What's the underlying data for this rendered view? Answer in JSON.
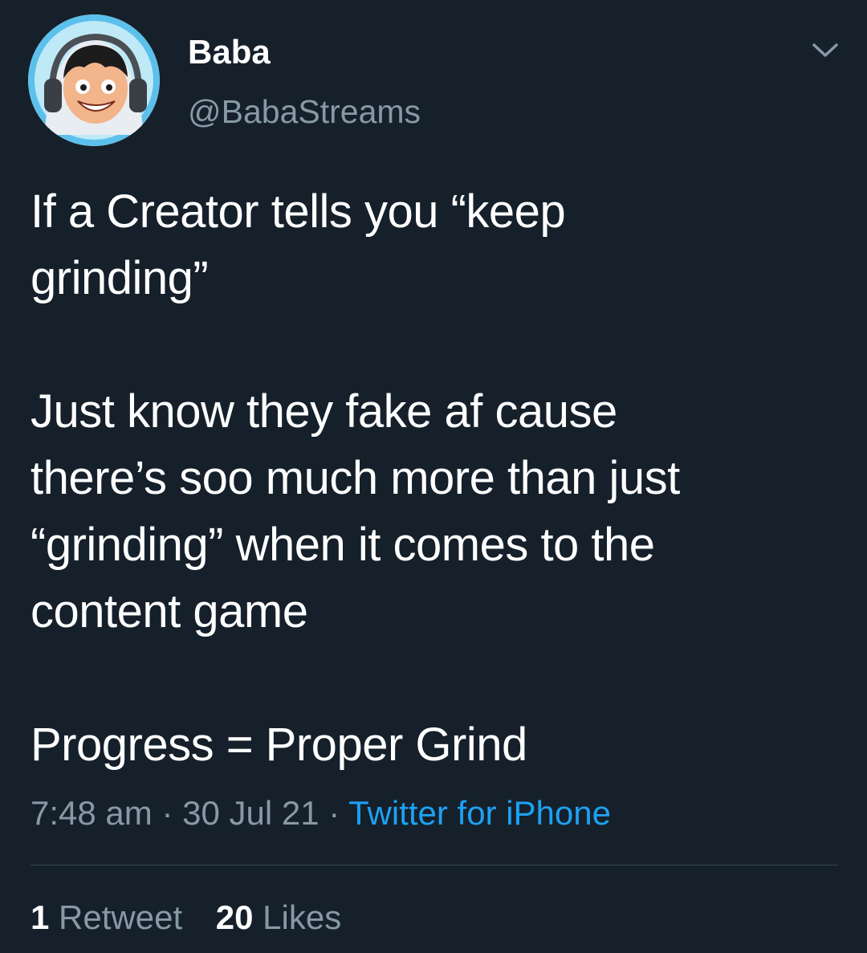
{
  "author": {
    "name": "Baba",
    "handle": "@BabaStreams"
  },
  "tweet": {
    "paragraphs": [
      [
        "If a Creator tells you “keep",
        "grinding”"
      ],
      [
        "Just know they fake af cause",
        "there’s soo much more than just",
        "“grinding” when it comes to the",
        "content game"
      ],
      [
        "Progress = Proper Grind"
      ]
    ]
  },
  "meta": {
    "time": "7:48 am",
    "separator": "·",
    "date": "30 Jul 21",
    "source": "Twitter for iPhone"
  },
  "stats": {
    "retweets_count": "1",
    "retweets_label": "Retweet",
    "likes_count": "20",
    "likes_label": "Likes"
  },
  "icons": {
    "more": "chevron-down-icon",
    "avatar": "avatar-illustration"
  },
  "colors": {
    "background": "#15202b",
    "primary_text": "#ffffff",
    "secondary_text": "#8899a6",
    "link": "#1da1f2",
    "divider": "#38444d"
  }
}
